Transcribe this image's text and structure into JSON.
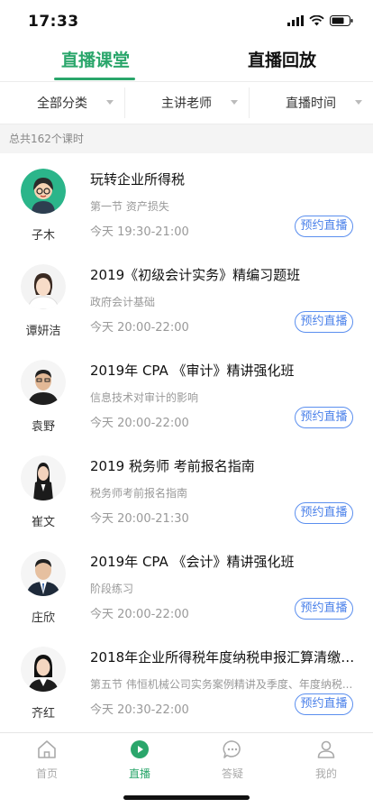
{
  "status": {
    "time": "17:33"
  },
  "tabs": [
    {
      "label": "直播课堂",
      "active": true
    },
    {
      "label": "直播回放",
      "active": false
    }
  ],
  "filters": [
    "全部分类",
    "主讲老师",
    "直播时间"
  ],
  "count_text": "总共162个课时",
  "courses": [
    {
      "teacher": "子木",
      "title": "玩转企业所得税",
      "subtitle": "第一节 资产损失",
      "time": "今天 19:30-21:00",
      "button": "预约直播"
    },
    {
      "teacher": "谭妍洁",
      "title": "2019《初级会计实务》精编习题班",
      "subtitle": "政府会计基础",
      "time": "今天 20:00-22:00",
      "button": "预约直播"
    },
    {
      "teacher": "袁野",
      "title": "2019年 CPA 《审计》精讲强化班",
      "subtitle": "信息技术对审计的影响",
      "time": "今天 20:00-22:00",
      "button": "预约直播"
    },
    {
      "teacher": "崔文",
      "title": "2019 税务师 考前报名指南",
      "subtitle": "税务师考前报名指南",
      "time": "今天 20:00-21:30",
      "button": "预约直播"
    },
    {
      "teacher": "庄欣",
      "title": "2019年 CPA 《会计》精讲强化班",
      "subtitle": "阶段练习",
      "time": "今天 20:00-22:00",
      "button": "预约直播"
    },
    {
      "teacher": "齐红",
      "title": "2018年企业所得税年度纳税申报汇算清缴实...",
      "subtitle": "第五节 伟恒机械公司实务案例精讲及季度、年度纳税...",
      "time": "今天 20:30-22:00",
      "button": "预约直播"
    }
  ],
  "bottom_nav": [
    {
      "label": "首页",
      "icon": "home-icon",
      "active": false
    },
    {
      "label": "直播",
      "icon": "play-icon",
      "active": true
    },
    {
      "label": "答疑",
      "icon": "chat-icon",
      "active": false
    },
    {
      "label": "我的",
      "icon": "user-icon",
      "active": false
    }
  ],
  "colors": {
    "accent": "#2aa66b",
    "button": "#4c82ea"
  }
}
